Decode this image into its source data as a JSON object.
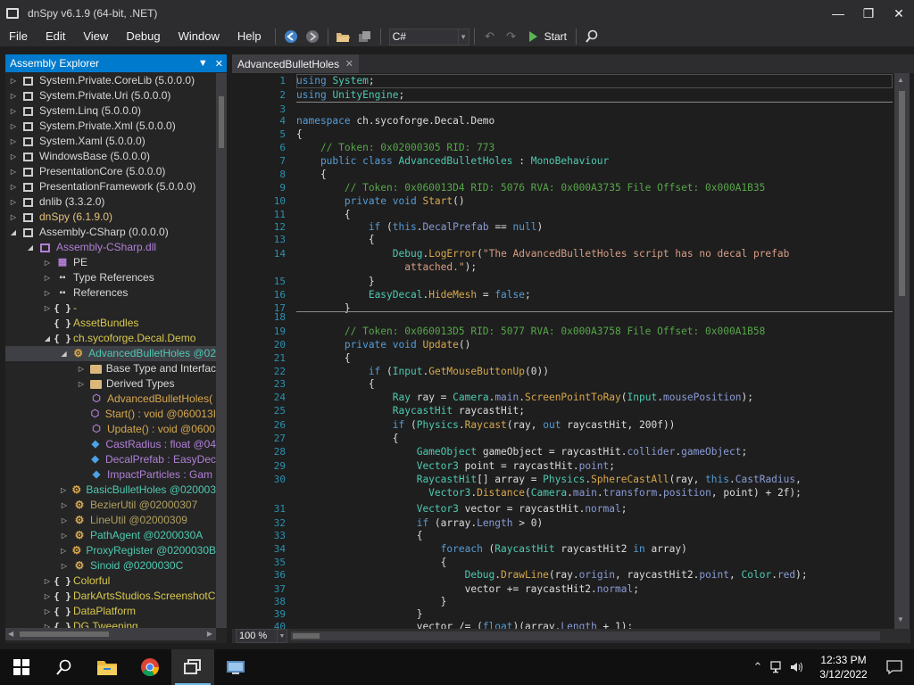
{
  "window": {
    "title": "dnSpy v6.1.9 (64-bit, .NET)"
  },
  "menu": [
    "File",
    "Edit",
    "View",
    "Debug",
    "Window",
    "Help"
  ],
  "toolbar": {
    "language": "C#",
    "start_label": "Start"
  },
  "explorer": {
    "title": "Assembly Explorer",
    "nodes": [
      {
        "label": "System.Private.CoreLib (5.0.0.0)",
        "icon": "assembly-icon",
        "color": "#d8d8d8"
      },
      {
        "label": "System.Private.Uri (5.0.0.0)",
        "icon": "assembly-icon",
        "color": "#d8d8d8"
      },
      {
        "label": "System.Linq (5.0.0.0)",
        "icon": "assembly-icon",
        "color": "#d8d8d8"
      },
      {
        "label": "System.Private.Xml (5.0.0.0)",
        "icon": "assembly-icon",
        "color": "#d8d8d8"
      },
      {
        "label": "System.Xaml (5.0.0.0)",
        "icon": "assembly-icon",
        "color": "#d8d8d8"
      },
      {
        "label": "WindowsBase (5.0.0.0)",
        "icon": "assembly-icon",
        "color": "#d8d8d8"
      },
      {
        "label": "PresentationCore (5.0.0.0)",
        "icon": "assembly-icon",
        "color": "#d8d8d8"
      },
      {
        "label": "PresentationFramework (5.0.0.0)",
        "icon": "assembly-icon",
        "color": "#d8d8d8"
      },
      {
        "label": "dnlib (3.3.2.0)",
        "icon": "assembly-icon",
        "color": "#d8d8d8"
      },
      {
        "label": "dnSpy (6.1.9.0)",
        "icon": "assembly-icon",
        "color": "#e5c07b"
      },
      {
        "label": "Assembly-CSharp (0.0.0.0)",
        "icon": "assembly-icon",
        "color": "#d8d8d8"
      },
      {
        "label": "Assembly-CSharp.dll",
        "icon": "module-icon",
        "color": "#b180d7"
      },
      {
        "label": "PE",
        "icon": "pe-icon",
        "color": "#d8d8d8"
      },
      {
        "label": "Type References",
        "icon": "reference-icon",
        "color": "#d8d8d8"
      },
      {
        "label": "References",
        "icon": "reference-icon",
        "color": "#d8d8d8"
      },
      {
        "label": "-",
        "icon": "namespace-icon",
        "color": "#d8c84c"
      },
      {
        "label": "AssetBundles",
        "icon": "namespace-icon",
        "color": "#d8c84c"
      },
      {
        "label": "ch.sycoforge.Decal.Demo",
        "icon": "namespace-icon",
        "color": "#d8c84c"
      },
      {
        "label": "AdvancedBulletHoles @02",
        "icon": "class-icon",
        "color": "#4ec9b0"
      },
      {
        "label": "Base Type and Interfac",
        "icon": "folder-icon",
        "color": "#d8d8d8"
      },
      {
        "label": "Derived Types",
        "icon": "folder-icon",
        "color": "#d8d8d8"
      },
      {
        "label": "AdvancedBulletHoles(",
        "icon": "method-icon",
        "color": "#d8a84c"
      },
      {
        "label": "Start() : void @060013I",
        "icon": "method-icon",
        "color": "#d8a84c"
      },
      {
        "label": "Update() : void @0600",
        "icon": "method-icon",
        "color": "#d8a84c"
      },
      {
        "label": "CastRadius : float @04",
        "icon": "field-icon",
        "color": "#b180d7"
      },
      {
        "label": "DecalPrefab : EasyDec",
        "icon": "field-icon",
        "color": "#b180d7"
      },
      {
        "label": "ImpactParticles : Gam",
        "icon": "field-icon",
        "color": "#b180d7"
      },
      {
        "label": "BasicBulletHoles @020003",
        "icon": "class-icon",
        "color": "#4ec9b0"
      },
      {
        "label": "BezierUtil @02000307",
        "icon": "class-icon",
        "color": "#b0a060"
      },
      {
        "label": "LineUtil @02000309",
        "icon": "class-icon",
        "color": "#b0a060"
      },
      {
        "label": "PathAgent @0200030A",
        "icon": "class-icon",
        "color": "#4ec9b0"
      },
      {
        "label": "ProxyRegister @0200030B",
        "icon": "class-icon",
        "color": "#4ec9b0"
      },
      {
        "label": "Sinoid @0200030C",
        "icon": "class-icon",
        "color": "#4ec9b0"
      },
      {
        "label": "Colorful",
        "icon": "namespace-icon",
        "color": "#d8c84c"
      },
      {
        "label": "DarkArtsStudios.ScreenshotC",
        "icon": "namespace-icon",
        "color": "#d8c84c"
      },
      {
        "label": "DataPlatform",
        "icon": "namespace-icon",
        "color": "#d8c84c"
      },
      {
        "label": "DG.Tweening",
        "icon": "namespace-icon",
        "color": "#d8c84c"
      }
    ]
  },
  "editor": {
    "tab": "AdvancedBulletHoles",
    "zoom": "100 %"
  },
  "taskbar": {
    "time": "12:33 PM",
    "date": "3/12/2022"
  }
}
